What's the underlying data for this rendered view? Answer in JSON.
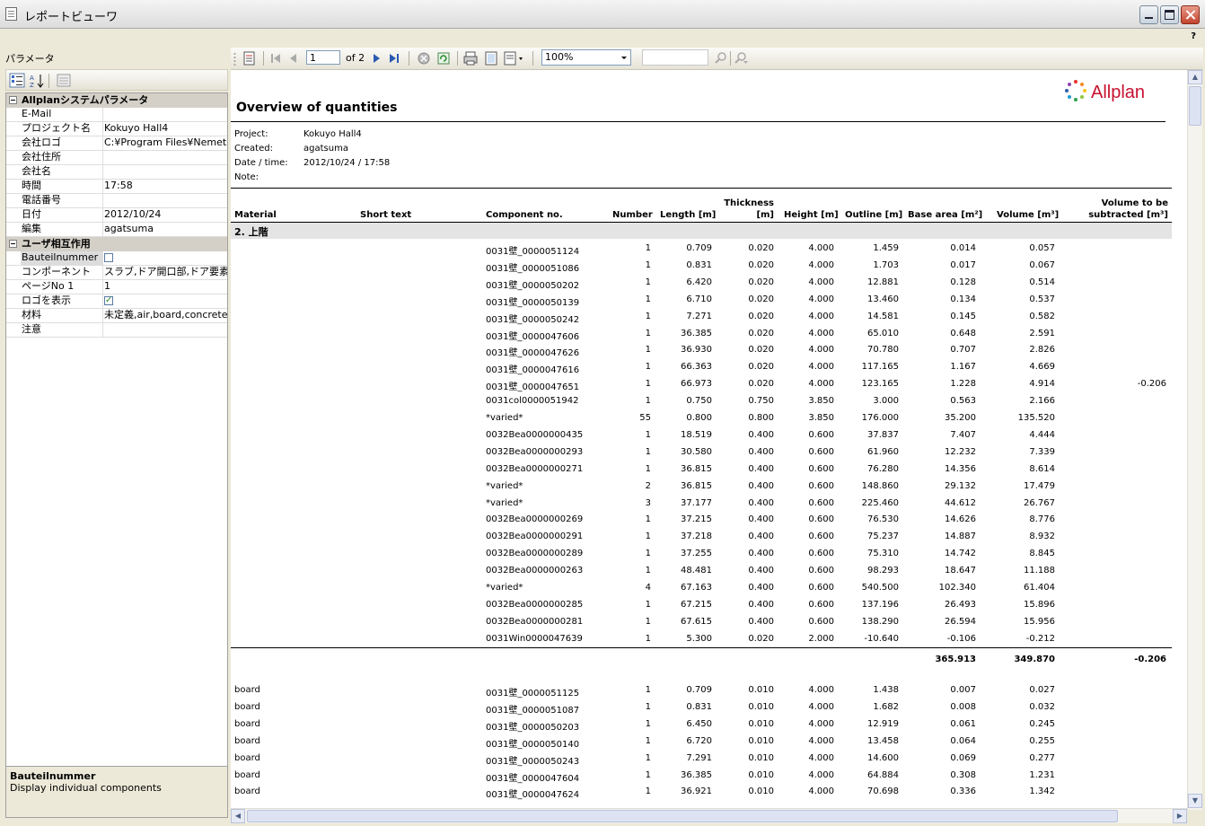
{
  "window": {
    "title": "レポートビューワ",
    "help_label": "?"
  },
  "params": {
    "title": "パラメータ",
    "description": {
      "title": "Bauteilnummer",
      "text": "Display individual components"
    }
  },
  "toolbar": {
    "page": "1",
    "of_pages": "of 2",
    "zoom": "100%"
  },
  "report": {
    "logo_text": "Allplan",
    "title": "Overview of quantities",
    "meta": [
      {
        "label": "Project:",
        "value": "Kokuyo Hall4"
      },
      {
        "label": "Created:",
        "value": "agatsuma"
      },
      {
        "label": "Date / time:",
        "value": "2012/10/24  /  17:58"
      },
      {
        "label": "Note:",
        "value": ""
      }
    ],
    "columns": {
      "material": "Material",
      "short_text": "Short text",
      "component": "Component no.",
      "number": "Number",
      "length": "Length [m]",
      "thickness_1": "Thickness",
      "thickness_2": "[m]",
      "height": "Height [m]",
      "outline": "Outline [m]",
      "base_area": "Base area [m²]",
      "volume": "Volume [m³]",
      "subtract_1": "Volume to be",
      "subtract_2": "subtracted [m³]"
    },
    "group_label": "2. 上階",
    "totals": {
      "base_area": "365.913",
      "volume": "349.870",
      "subtract": "-0.206"
    }
  }
}
